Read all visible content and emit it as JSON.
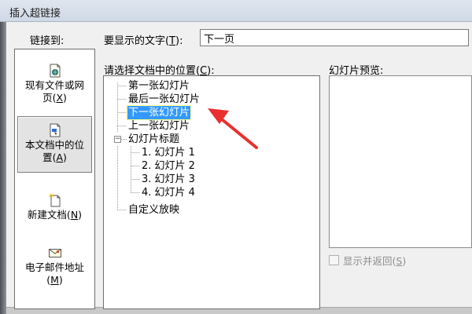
{
  "window": {
    "title": "插入超链接"
  },
  "link_to": {
    "label": "链接到:",
    "places": [
      {
        "line1": "现有文件或网",
        "line2": "页(",
        "key": "X",
        "close": ")"
      },
      {
        "line1": "本文档中的位",
        "line2": "置(",
        "key": "A",
        "close": ")"
      },
      {
        "line1": "新建文档(",
        "key": "N",
        "close": ")"
      },
      {
        "line1": "电子邮件地址",
        "line2": "(",
        "key": "M",
        "close": ")"
      }
    ]
  },
  "display_text": {
    "label_prefix": "要显示的文字(",
    "label_key": "T",
    "label_suffix": "):",
    "value": "下一页"
  },
  "doc_place": {
    "label_prefix": "请选择文档中的位置(",
    "label_key": "C",
    "label_suffix": "):",
    "nodes": [
      {
        "label": "第一张幻灯片"
      },
      {
        "label": "最后一张幻灯片"
      },
      {
        "label": "下一张幻灯片",
        "selected": true
      },
      {
        "label": "上一张幻灯片"
      },
      {
        "label": "幻灯片标题",
        "expander": "−"
      },
      {
        "label": "1. 幻灯片 1"
      },
      {
        "label": "2. 幻灯片 2"
      },
      {
        "label": "3. 幻灯片 3"
      },
      {
        "label": "4. 幻灯片 4"
      },
      {
        "label": "自定义放映"
      }
    ]
  },
  "preview": {
    "label": "幻灯片预览:",
    "show_return_prefix": "显示并返回(",
    "show_return_key": "S",
    "show_return_suffix": ")",
    "show_return_checked": false
  },
  "colors": {
    "selection": "#3399ff",
    "arrow": "#e8302e"
  },
  "icons": {
    "place_web": "web-page-icon",
    "place_doc": "document-place-icon",
    "place_new": "new-document-icon",
    "place_mail": "email-icon"
  }
}
